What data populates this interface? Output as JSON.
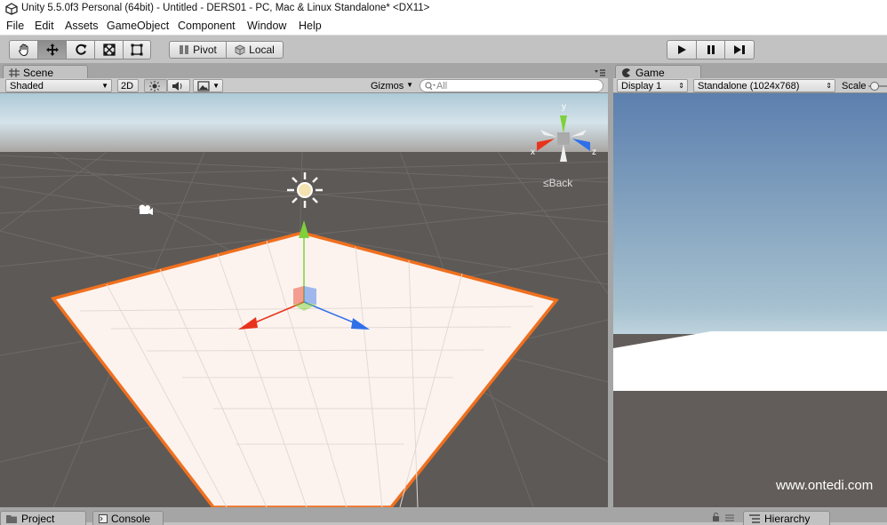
{
  "window": {
    "title": "Unity 5.5.0f3 Personal (64bit) - Untitled - DERS01 - PC, Mac & Linux Standalone* <DX11>"
  },
  "menu": [
    "File",
    "Edit",
    "Assets",
    "GameObject",
    "Component",
    "Window",
    "Help"
  ],
  "toolbar": {
    "tools": [
      "hand-tool",
      "move-tool",
      "rotate-tool",
      "scale-tool",
      "rect-tool"
    ],
    "active_tool": "move-tool",
    "pivot_label": "Pivot",
    "local_label": "Local",
    "play_controls": [
      "play",
      "pause",
      "step"
    ]
  },
  "scene": {
    "tab_label": "Scene",
    "shading_mode": "Shaded",
    "mode_2d": "2D",
    "gizmos_label": "Gizmos",
    "search_placeholder": "All",
    "orientation_label": "Back",
    "axis_labels": {
      "x": "x",
      "y": "y",
      "z": "z"
    }
  },
  "game": {
    "tab_label": "Game",
    "display": "Display 1",
    "resolution": "Standalone (1024x768)",
    "scale_label": "Scale"
  },
  "bottom_tabs": {
    "project": "Project",
    "console": "Console",
    "hierarchy": "Hierarchy"
  },
  "watermark": "www.ontedi.com",
  "colors": {
    "selection_outline": "#f0701e",
    "axis_x": "#e8341c",
    "axis_y": "#7ed13a",
    "axis_z": "#2f6fe8",
    "sky": "#bfd8e6"
  }
}
